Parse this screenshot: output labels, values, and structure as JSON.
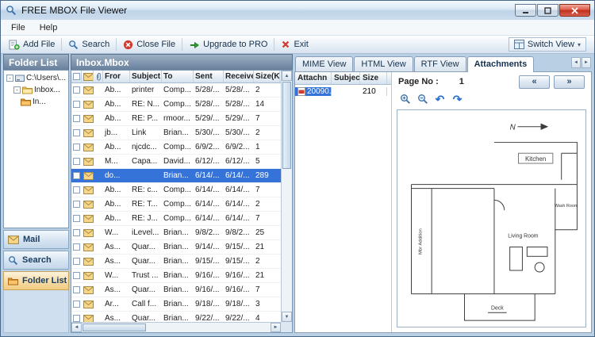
{
  "window": {
    "title": "FREE MBOX File Viewer",
    "icon": "magnifier-icon"
  },
  "menu": {
    "items": [
      {
        "label": "File"
      },
      {
        "label": "Help"
      }
    ]
  },
  "toolbar": {
    "buttons": [
      {
        "label": "Add File",
        "icon": "add-file-icon"
      },
      {
        "label": "Search",
        "icon": "search-icon"
      },
      {
        "label": "Close File",
        "icon": "close-file-icon"
      },
      {
        "label": "Upgrade to PRO",
        "icon": "upgrade-icon"
      },
      {
        "label": "Exit",
        "icon": "exit-icon"
      }
    ],
    "switch_view": {
      "label": "Switch View",
      "icon": "switch-view-icon",
      "dropdown": "▾"
    }
  },
  "folder_panel": {
    "title": "Folder List",
    "tree": [
      {
        "label": "C:\\Users\\...",
        "level": 0,
        "icon": "drive-icon",
        "expander": "-"
      },
      {
        "label": "Inbox...",
        "level": 1,
        "icon": "folder-icon",
        "expander": "-"
      },
      {
        "label": "In...",
        "level": 2,
        "icon": "folder-orange-icon",
        "expander": ""
      }
    ],
    "nav": [
      {
        "label": "Mail",
        "icon": "mail-nav-icon",
        "active": false
      },
      {
        "label": "Search",
        "icon": "search-icon",
        "active": false
      },
      {
        "label": "Folder List",
        "icon": "folder-orange-icon",
        "active": true
      }
    ]
  },
  "mail_panel": {
    "title": "Inbox.Mbox",
    "columns": {
      "from": "Fror",
      "subject": "Subject",
      "to": "To",
      "sent": "Sent",
      "receive": "Receive",
      "size": "Size(KB)"
    },
    "rows": [
      {
        "from": "Ab...",
        "subject": "printer",
        "to": "Comp...",
        "sent": "5/28/...",
        "receive": "5/28/...",
        "size": "2",
        "selected": false
      },
      {
        "from": "Ab...",
        "subject": "RE: N...",
        "to": "Comp...",
        "sent": "5/28/...",
        "receive": "5/28/...",
        "size": "14",
        "selected": false
      },
      {
        "from": "Ab...",
        "subject": "RE: P...",
        "to": "rmoor...",
        "sent": "5/29/...",
        "receive": "5/29/...",
        "size": "7",
        "selected": false
      },
      {
        "from": "jb...",
        "subject": "Link",
        "to": "Brian...",
        "sent": "5/30/...",
        "receive": "5/30/...",
        "size": "2",
        "selected": false
      },
      {
        "from": "Ab...",
        "subject": "njcdc...",
        "to": "Comp...",
        "sent": "6/9/2...",
        "receive": "6/9/2...",
        "size": "1",
        "selected": false
      },
      {
        "from": "M...",
        "subject": "Capa...",
        "to": "David...",
        "sent": "6/12/...",
        "receive": "6/12/...",
        "size": "5",
        "selected": false
      },
      {
        "from": "do...",
        "subject": "",
        "to": "Brian...",
        "sent": "6/14/...",
        "receive": "6/14/...",
        "size": "289",
        "selected": true
      },
      {
        "from": "Ab...",
        "subject": "RE: c...",
        "to": "Comp...",
        "sent": "6/14/...",
        "receive": "6/14/...",
        "size": "7",
        "selected": false
      },
      {
        "from": "Ab...",
        "subject": "RE: T...",
        "to": "Comp...",
        "sent": "6/14/...",
        "receive": "6/14/...",
        "size": "2",
        "selected": false
      },
      {
        "from": "Ab...",
        "subject": "RE: J...",
        "to": "Comp...",
        "sent": "6/14/...",
        "receive": "6/14/...",
        "size": "7",
        "selected": false
      },
      {
        "from": "W...",
        "subject": "iLevel...",
        "to": "Brian...",
        "sent": "9/8/2...",
        "receive": "9/8/2...",
        "size": "25",
        "selected": false
      },
      {
        "from": "As...",
        "subject": "Quar...",
        "to": "Brian...",
        "sent": "9/14/...",
        "receive": "9/15/...",
        "size": "21",
        "selected": false
      },
      {
        "from": "As...",
        "subject": "Quar...",
        "to": "Brian...",
        "sent": "9/15/...",
        "receive": "9/15/...",
        "size": "2",
        "selected": false
      },
      {
        "from": "W...",
        "subject": "Trust ...",
        "to": "Brian...",
        "sent": "9/16/...",
        "receive": "9/16/...",
        "size": "21",
        "selected": false
      },
      {
        "from": "As...",
        "subject": "Quar...",
        "to": "Brian...",
        "sent": "9/16/...",
        "receive": "9/16/...",
        "size": "7",
        "selected": false
      },
      {
        "from": "Ar...",
        "subject": "Call f...",
        "to": "Brian...",
        "sent": "9/18/...",
        "receive": "9/18/...",
        "size": "3",
        "selected": false
      },
      {
        "from": "As...",
        "subject": "Quar...",
        "to": "Brian...",
        "sent": "9/22/...",
        "receive": "9/22/...",
        "size": "4",
        "selected": false
      }
    ]
  },
  "preview_panel": {
    "tabs": [
      {
        "label": "MIME View",
        "active": false
      },
      {
        "label": "HTML View",
        "active": false
      },
      {
        "label": "RTF View",
        "active": false
      },
      {
        "label": "Attachments",
        "active": true
      }
    ],
    "tab_scroll": {
      "left": "◄",
      "right": "►"
    },
    "attachments": {
      "columns": [
        "Attachn",
        "Subject",
        "Size"
      ],
      "rows": [
        {
          "name": "20090...",
          "subject": "",
          "size": "210",
          "icon": "pdf-icon",
          "selected": true
        }
      ]
    },
    "pager": {
      "label": "Page No :",
      "value": "1",
      "prev": "«",
      "next": "»"
    },
    "viewer_toolbar": [
      {
        "icon": "zoom-in-icon"
      },
      {
        "icon": "zoom-out-icon"
      },
      {
        "icon": "undo-icon"
      },
      {
        "icon": "redo-icon"
      }
    ],
    "floorplan": {
      "north": "N",
      "kitchen": "Kitchen",
      "living_room": "Living Room",
      "wash_room": "Wash Room",
      "deck": "Deck",
      "addition": "Mbr Addition"
    }
  },
  "scrollbar": {
    "up": "▲",
    "down": "▼",
    "left": "◄",
    "right": "►"
  }
}
